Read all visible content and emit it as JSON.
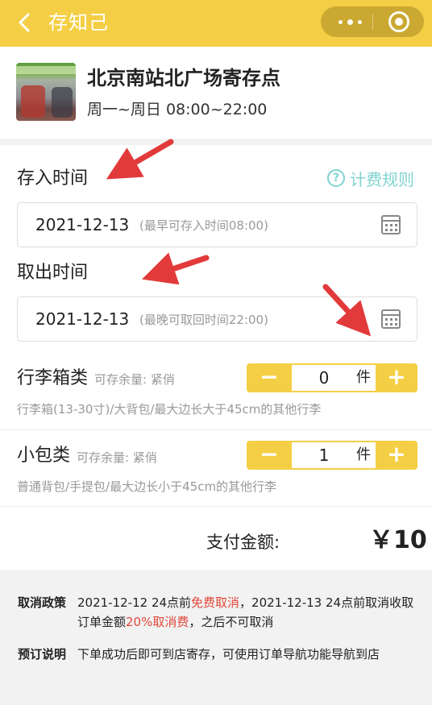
{
  "header": {
    "title": "存知己",
    "back_icon": "chevron-left-icon",
    "more_icon": "more-dots-icon",
    "close_icon": "target-circle-icon"
  },
  "store": {
    "name": "北京南站北广场寄存点",
    "hours": "周一~周日 08:00~22:00"
  },
  "deposit": {
    "label": "存入时间",
    "rule_link": "计费规则",
    "date": "2021-12-13",
    "hint": "(最早可存入时间08:00)"
  },
  "pickup": {
    "label": "取出时间",
    "date": "2021-12-13",
    "hint": "(最晚可取回时间22:00)"
  },
  "luggage": [
    {
      "title": "行李箱类",
      "stock": "可存余量: 紧俏",
      "quantity": "0",
      "unit": "件",
      "minus": "−",
      "plus": "+",
      "desc": "行李箱(13-30寸)/大背包/最大边长大于45cm的其他行李"
    },
    {
      "title": "小包类",
      "stock": "可存余量: 紧俏",
      "quantity": "1",
      "unit": "件",
      "minus": "−",
      "plus": "+",
      "desc": "普通背包/手提包/最大边长小于45cm的其他行李"
    }
  ],
  "payment": {
    "label": "支付金额:",
    "amount": "￥10"
  },
  "policy": {
    "cancel_title": "取消政策",
    "cancel_p1": "2021-12-12 24点前",
    "cancel_free": "免费取消",
    "cancel_p2": "，2021-12-13 24点前取消收取订单金额",
    "cancel_fee": "20%取消费",
    "cancel_p3": "，之后不可取消",
    "booking_title": "预订说明",
    "booking_text": "下单成功后即可到店寄存，可使用订单导航功能导航到店"
  },
  "colors": {
    "brand_yellow": "#f4cf45",
    "link_teal": "#7fd3d0",
    "policy_red": "#e2473a",
    "annotation_arrow": "#e23a3a"
  }
}
